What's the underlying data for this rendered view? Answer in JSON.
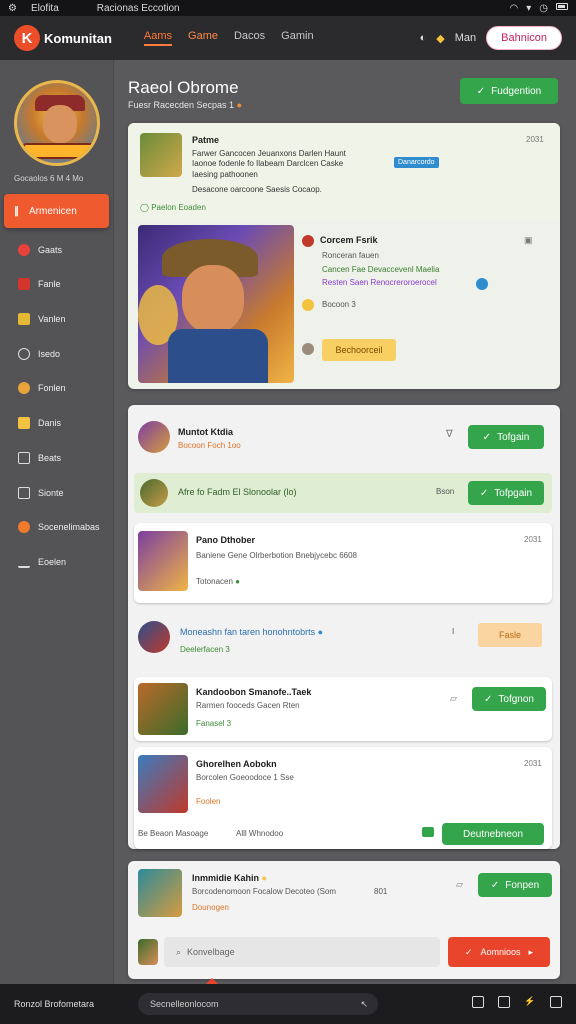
{
  "status": {
    "time": "⚙",
    "app": "Elofita",
    "title": "Racionas Eccotion"
  },
  "nav": {
    "brand": "Komunitan",
    "links": [
      "Aams",
      "Game",
      "Dacos",
      "Gamin"
    ],
    "right_text": "Man",
    "pill_button": "Bahnicon"
  },
  "sidebar": {
    "subtitle": "Gocaolos 6 M 4 Mo",
    "active_label": "Armenicen",
    "items": [
      "Gaats",
      "Fanle",
      "Vanlen",
      "Isedo",
      "Fonlen",
      "Danis",
      "Beats",
      "Sionte",
      "Socenelimabas",
      "Eoelen"
    ]
  },
  "page": {
    "title": "Raeol Obrome",
    "subtitle": "Fuesr Racecden Secpas 1",
    "top_button": "Fudgention"
  },
  "post1": {
    "author": "Patme",
    "line1": "Farwer Gancocen Jeuanxons Darlen Haunt",
    "line2": "Iaonoe fodenle fo Ilabeam Darclcen Caske",
    "line3": "Iaesing pathoonen",
    "line4": "Desacone oarcoone Saesis Cocaop.",
    "tag": "Danarcordo",
    "date": "2031",
    "likes": "Paelon Eoaden",
    "panel_author": "Corcem Fsrik",
    "panel_line1": "Ronceran fauen",
    "panel_line2": "Cancen Fae Devaccevenl Maelia",
    "panel_line3": "Resten Saen Renocreroroerocel",
    "panel_count": "Bocoon 3",
    "panel_button": "Bechoorceil"
  },
  "rows": {
    "r1_title": "Muntot Ktdia",
    "r1_sub": "Bocoon Foch 1oo",
    "r1_button": "Tofgain",
    "r2_text": "Afre fo Fadm El Slonoolar (lo)",
    "r2_side": "Bson",
    "r2_button": "Tofpgain",
    "r3_title": "Pano Dthober",
    "r3_line": "Baniene Gene Olrberbotion Bnebjycebc 6608",
    "r3_meta": "Totonacen",
    "r3_date": "2031",
    "r4_title": "Moneashn fan taren honohntobrts",
    "r4_sub": "Deelerfacen 3",
    "r4_side": "I",
    "r4_button": "Fasle",
    "r5_title": "Kandoobon Smanofe..Taek",
    "r5_line": "Rarmen fooceds Gacen Rten",
    "r5_meta": "Fanasel 3",
    "r5_button": "Tofgnon",
    "r6_title": "Ghorelhen Aobokn",
    "r6_line": "Borcolen Goeoodoce 1 Sse",
    "r6_meta": "Foolen",
    "r6_date": "2031",
    "r6_footer_left": "Be Beaon Masoage",
    "r6_footer_mid": "Alll Whnodoo",
    "r6_button": "Deutnebneon"
  },
  "bottom_card": {
    "title": "Inmmidie Kahin",
    "line": "Borcodenomoon Focalow Decoteo (Som",
    "date": "801",
    "meta": "Dounogen",
    "button": "Fonpen",
    "input_placeholder": "Konvelbage",
    "send_button": "Aomnioos"
  },
  "bottombar": {
    "left": "Ronzol Brofometara",
    "search": "Secnelleonlocom"
  },
  "colors": {
    "accent": "#ef5a2e",
    "green": "#34a54b",
    "blue": "#2f8ccf",
    "pink": "#c22461"
  }
}
